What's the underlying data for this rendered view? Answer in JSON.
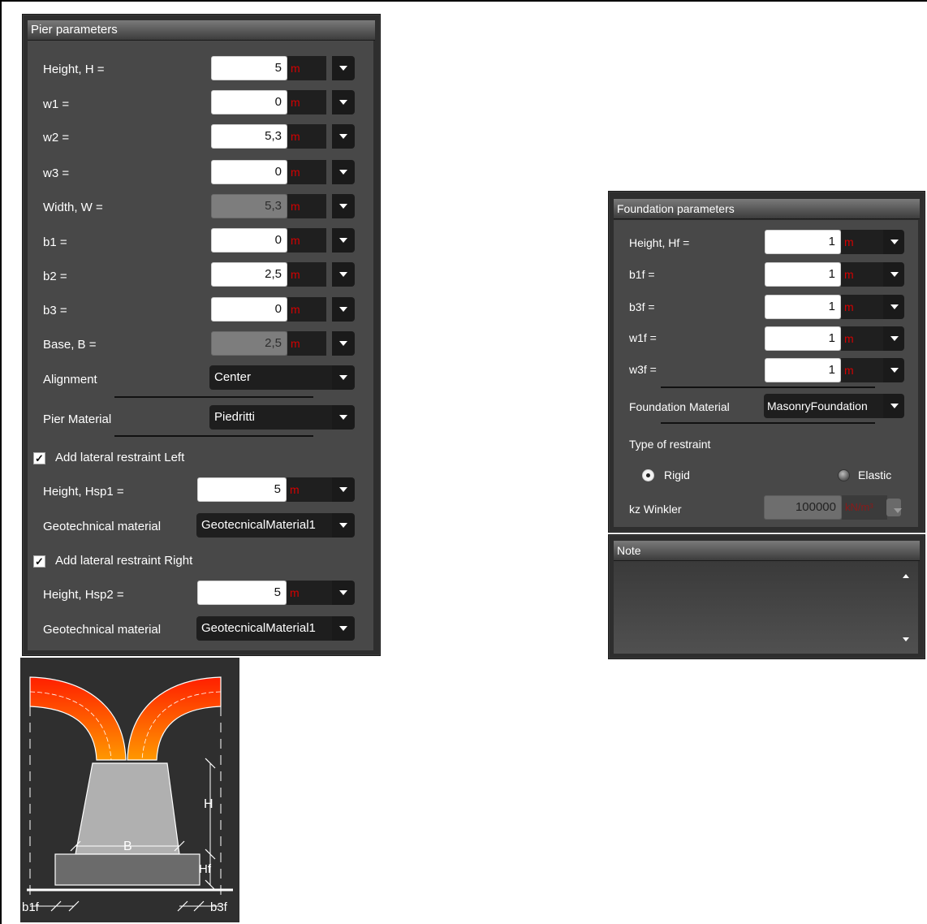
{
  "pier": {
    "title": "Pier parameters",
    "rows": [
      {
        "label": "Height, H =",
        "value": "5",
        "unit": "m"
      },
      {
        "label": "w1 =",
        "value": "0",
        "unit": "m"
      },
      {
        "label": "w2 =",
        "value": "5,3",
        "unit": "m"
      },
      {
        "label": "w3 =",
        "value": "0",
        "unit": "m"
      },
      {
        "label": "Width, W =",
        "value": "5,3",
        "unit": "m"
      },
      {
        "label": "b1 =",
        "value": "0",
        "unit": "m"
      },
      {
        "label": "b2 =",
        "value": "2,5",
        "unit": "m"
      },
      {
        "label": "b3 =",
        "value": "0",
        "unit": "m"
      },
      {
        "label": "Base, B =",
        "value": "2,5",
        "unit": "m"
      }
    ],
    "alignment_label": "Alignment",
    "alignment_value": "Center",
    "material_label": "Pier Material",
    "material_value": "Piedritti",
    "restraint_left_label": "Add lateral restraint Left",
    "restraint_left_checked": true,
    "hsp1_label": "Height, Hsp1 =",
    "hsp1_value": "5",
    "hsp1_unit": "m",
    "geo1_label": "Geotechnical material",
    "geo1_value": "GeotecnicalMaterial1",
    "restraint_right_label": "Add lateral restraint Right",
    "restraint_right_checked": true,
    "hsp2_label": "Height, Hsp2 =",
    "hsp2_value": "5",
    "hsp2_unit": "m",
    "geo2_label": "Geotechnical material",
    "geo2_value": "GeotecnicalMaterial1"
  },
  "foundation": {
    "title": "Foundation parameters",
    "rows": [
      {
        "label": "Height, Hf =",
        "value": "1",
        "unit": "m"
      },
      {
        "label": "b1f =",
        "value": "1",
        "unit": "m"
      },
      {
        "label": "b3f =",
        "value": "1",
        "unit": "m"
      },
      {
        "label": "w1f =",
        "value": "1",
        "unit": "m"
      },
      {
        "label": "w3f =",
        "value": "1",
        "unit": "m"
      }
    ],
    "material_label": "Foundation Material",
    "material_value": "MasonryFoundation",
    "restraint_type_label": "Type of restraint",
    "rigid_label": "Rigid",
    "elastic_label": "Elastic",
    "selected_restraint": "Rigid",
    "kz_label": "kz Winkler",
    "kz_value": "100000",
    "kz_unit": "kN/m³"
  },
  "note": {
    "title": "Note"
  },
  "diagram": {
    "label_H": "H",
    "label_B": "B",
    "label_Hf": "Hf",
    "label_b1f": "b1f",
    "label_b3f": "b3f"
  },
  "colors": {
    "unit_red": "#d40000",
    "panel_bg": "#484848",
    "arch_outer": "#ff2a00",
    "arch_inner": "#ff8a00"
  }
}
